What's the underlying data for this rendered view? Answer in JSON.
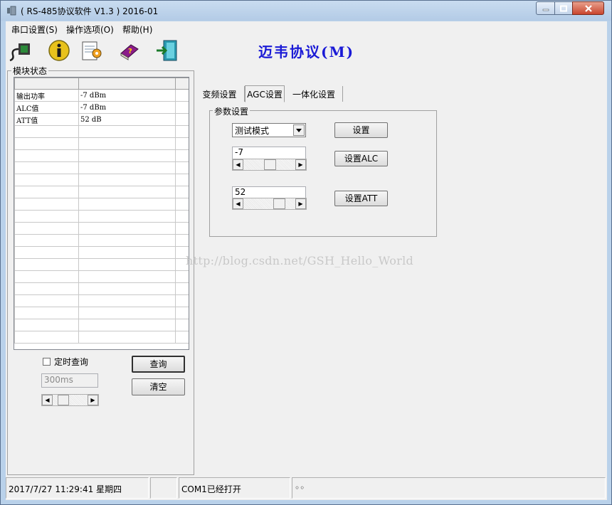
{
  "window": {
    "title": "( RS-485协议软件 V1.3 ) 2016-01"
  },
  "menu": {
    "items": [
      "串口设置(S)",
      "操作选项(O)",
      "帮助(H)"
    ]
  },
  "toolbar": {
    "icons": [
      "serial-port-icon",
      "info-icon",
      "settings-notepad-icon",
      "help-book-icon",
      "exit-door-icon"
    ],
    "brand_title": "迈韦协议(M)",
    "brand_color": "#1a1ad6"
  },
  "module_status": {
    "group_label": "模块状态",
    "rows": [
      {
        "name": "输出功率",
        "value": "-7 dBm"
      },
      {
        "name": "ALC值",
        "value": "-7 dBm"
      },
      {
        "name": "ATT值",
        "value": "52 dB"
      }
    ],
    "timed_query_label": "定时查询",
    "timed_query_checked": false,
    "interval_value": "300ms",
    "query_button": "查询",
    "clear_button": "清空"
  },
  "tabs": [
    {
      "label": "变频设置",
      "active": false
    },
    {
      "label": "AGC设置",
      "active": true
    },
    {
      "label": "一体化设置",
      "active": false
    }
  ],
  "params": {
    "group_label": "参数设置",
    "mode_select": "测试模式",
    "set_button": "设置",
    "alc_value": "-7",
    "set_alc_button": "设置ALC",
    "att_value": "52",
    "set_att_button": "设置ATT"
  },
  "watermark": "http://blog.csdn.net/GSH_Hello_World",
  "status_bar": {
    "datetime": "2017/7/27 11:29:41 星期四",
    "empty": "",
    "port_status": "COM1已经打开",
    "indicator": "◦◦"
  }
}
